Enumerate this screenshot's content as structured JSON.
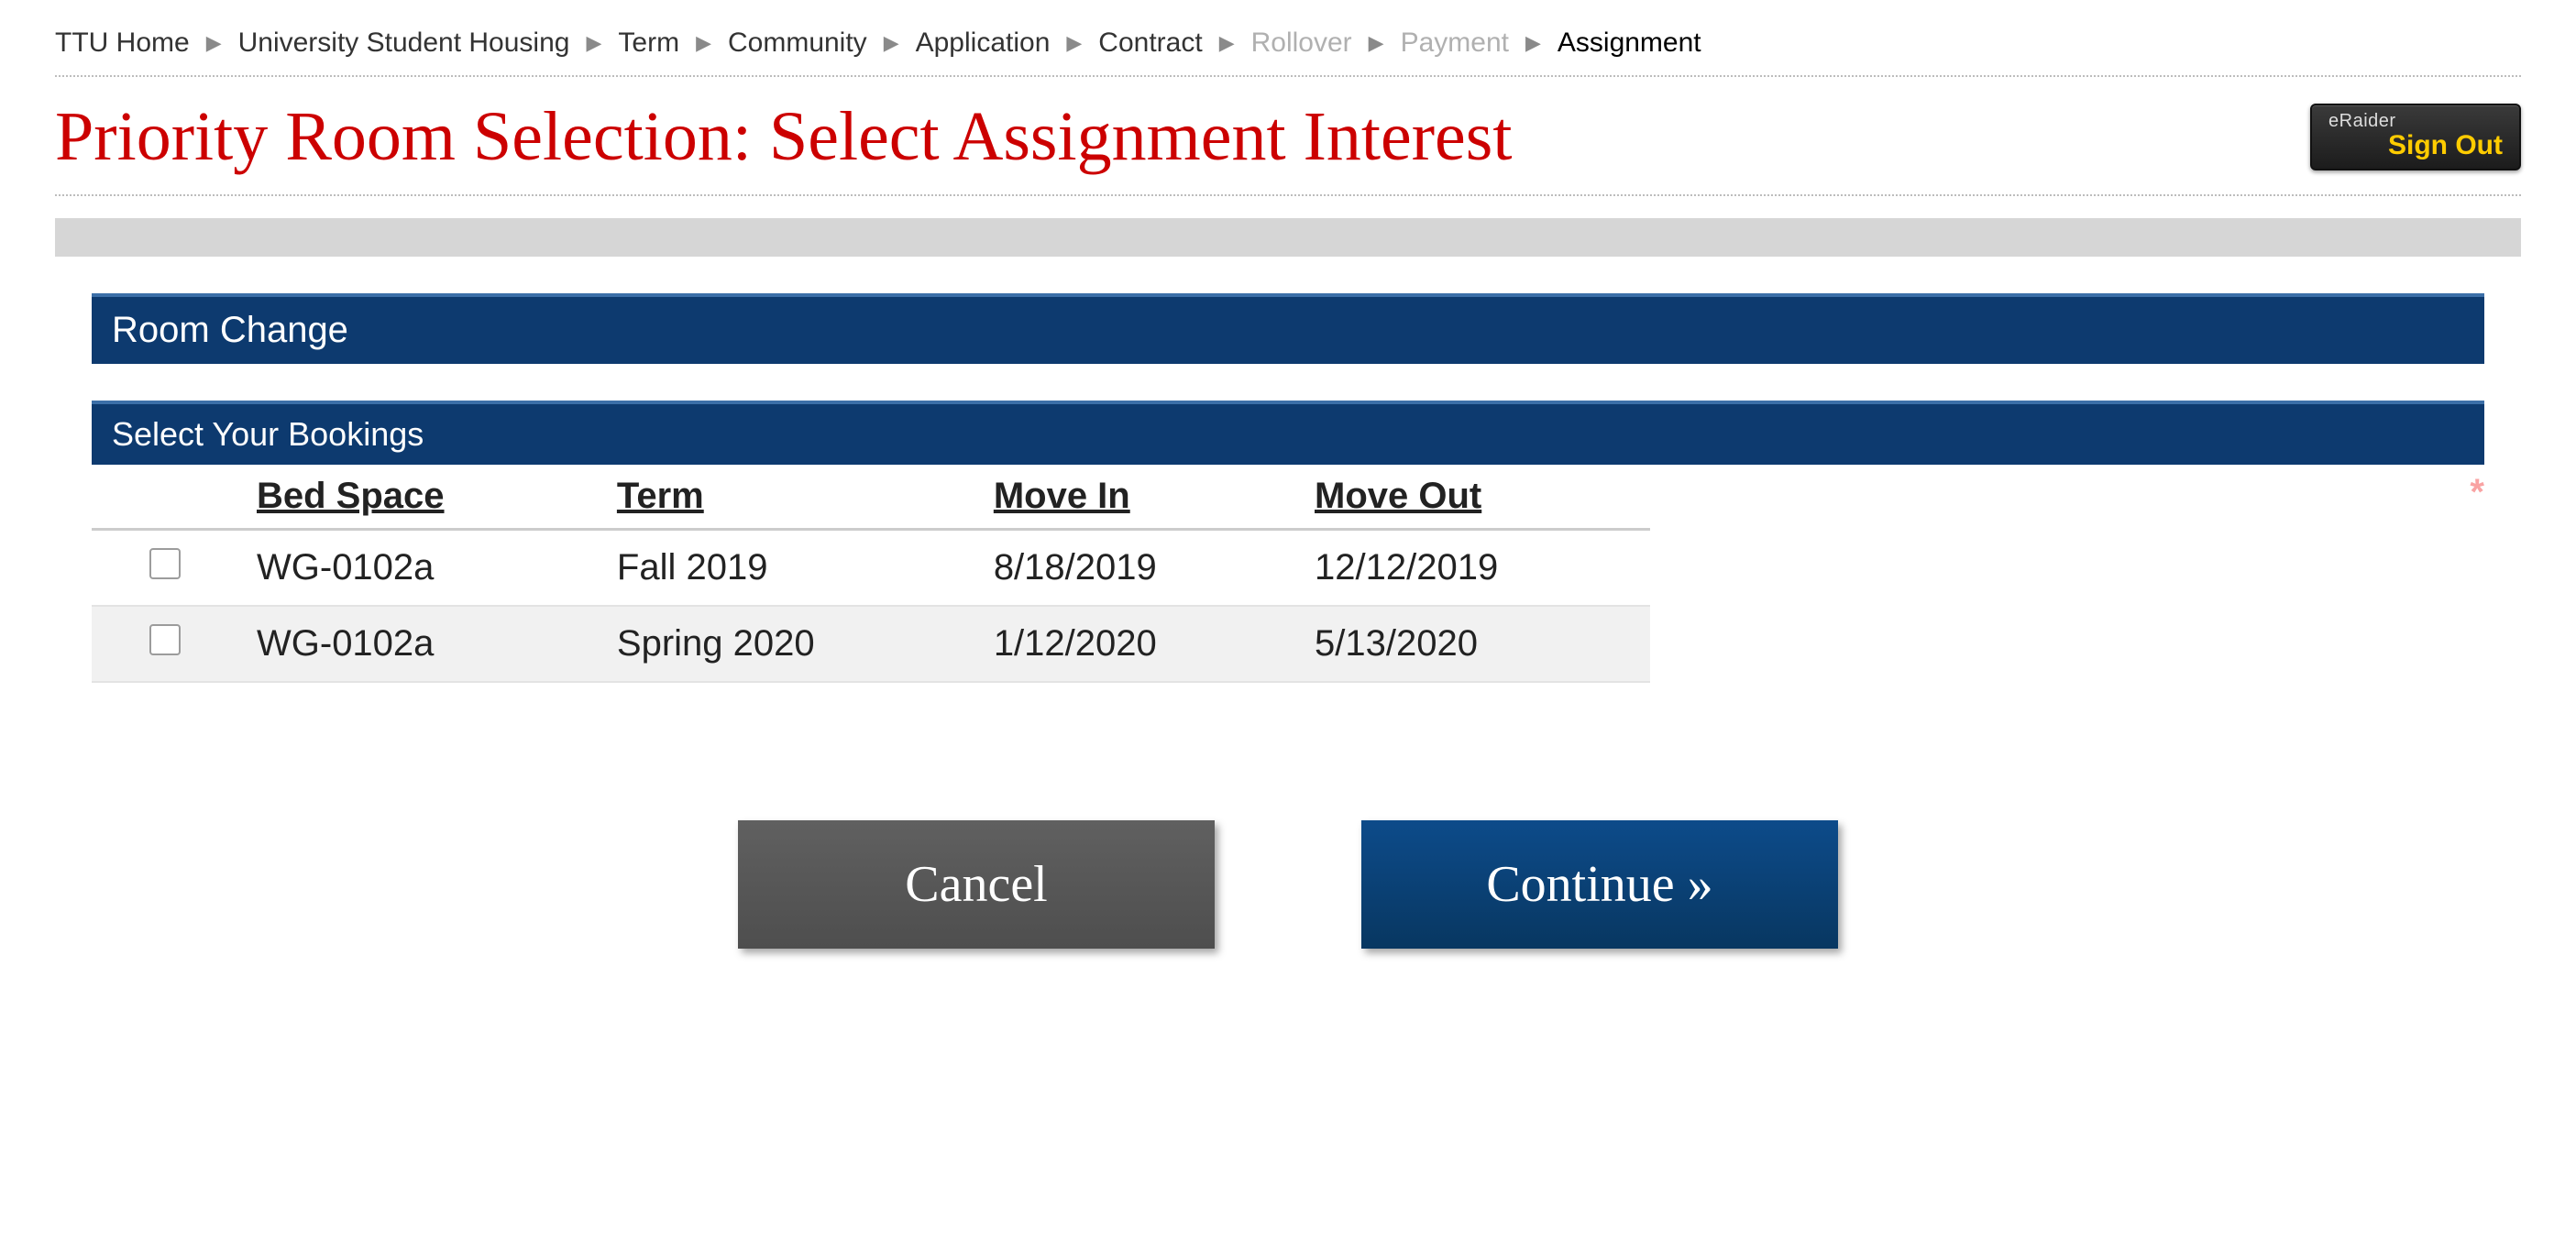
{
  "breadcrumb": {
    "items": [
      {
        "label": "TTU Home",
        "state": "link"
      },
      {
        "label": "University Student Housing",
        "state": "link"
      },
      {
        "label": "Term",
        "state": "link"
      },
      {
        "label": "Community",
        "state": "link"
      },
      {
        "label": "Application",
        "state": "link"
      },
      {
        "label": "Contract",
        "state": "link"
      },
      {
        "label": "Rollover",
        "state": "disabled"
      },
      {
        "label": "Payment",
        "state": "disabled"
      },
      {
        "label": "Assignment",
        "state": "current"
      }
    ]
  },
  "header": {
    "title": "Priority Room Selection: Select Assignment Interest",
    "sign_out": {
      "brand": "eRaider",
      "label": "Sign Out"
    }
  },
  "section": {
    "main_label": "Room Change",
    "sub_label": "Select Your Bookings"
  },
  "table": {
    "columns": {
      "bed_space": "Bed Space",
      "term": "Term",
      "move_in": "Move In",
      "move_out": "Move Out"
    },
    "rows": [
      {
        "bed_space": "WG-0102a",
        "term": "Fall 2019",
        "move_in": "8/18/2019",
        "move_out": "12/12/2019"
      },
      {
        "bed_space": "WG-0102a",
        "term": "Spring 2020",
        "move_in": "1/12/2020",
        "move_out": "5/13/2020"
      }
    ],
    "required_marker": "*"
  },
  "buttons": {
    "cancel": "Cancel",
    "continue": "Continue »"
  }
}
